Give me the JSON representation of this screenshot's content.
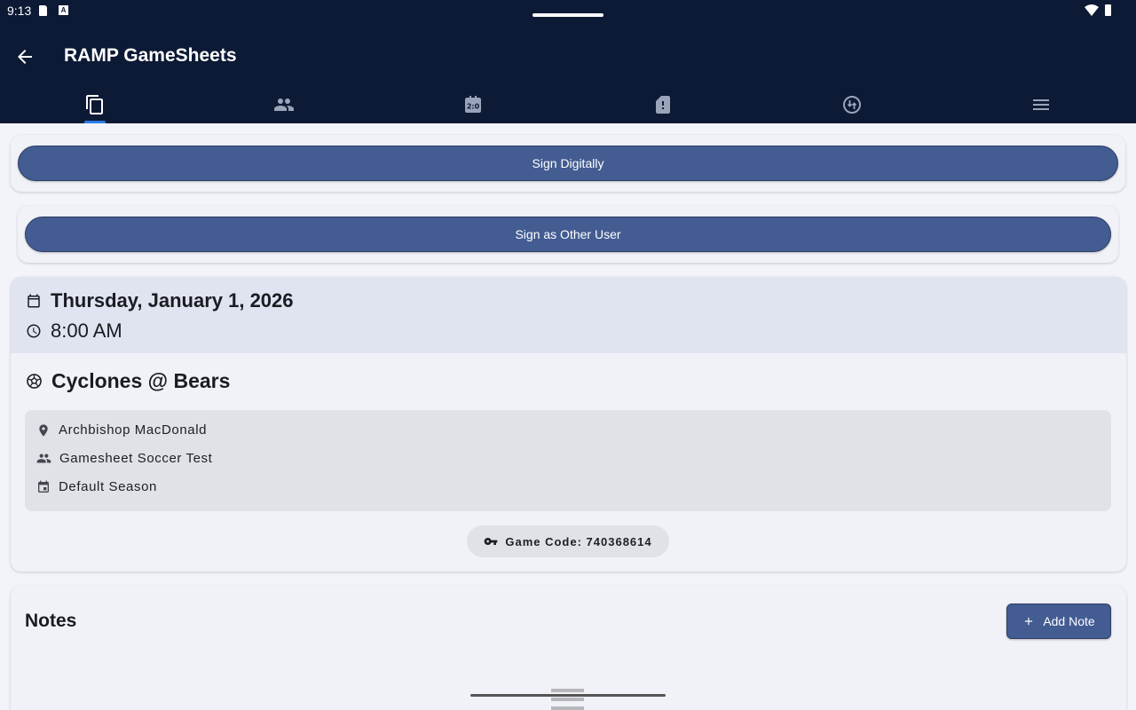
{
  "status_bar": {
    "time": "9:13",
    "notification_icons": [
      "sd-card-icon",
      "a-notification-icon"
    ],
    "right_icons": [
      "wifi-icon",
      "battery-icon"
    ]
  },
  "app_bar": {
    "title": "RAMP GameSheets"
  },
  "tabs": [
    {
      "icon": "copy-pages-icon",
      "selected": true
    },
    {
      "icon": "people-icon",
      "selected": false
    },
    {
      "icon": "scoreboard-icon",
      "selected": false
    },
    {
      "icon": "card-alert-icon",
      "selected": false
    },
    {
      "icon": "swap-circle-icon",
      "selected": false
    },
    {
      "icon": "menu-icon",
      "selected": false
    }
  ],
  "actions": {
    "sign_digitally": "Sign Digitally",
    "sign_other": "Sign as Other User"
  },
  "game": {
    "date": "Thursday, January 1, 2026",
    "time": "8:00 AM",
    "matchup": "Cyclones @ Bears",
    "venue": "Archbishop MacDonald",
    "league": "Gamesheet Soccer Test",
    "season": "Default Season",
    "game_code": "Game Code: 740368614"
  },
  "notes": {
    "title": "Notes",
    "add_label": "Add Note"
  },
  "colors": {
    "app_bar": "#0c1a35",
    "primary_button": "#435c92",
    "tab_indicator": "#2f7be6",
    "background": "#f3f4f9"
  }
}
